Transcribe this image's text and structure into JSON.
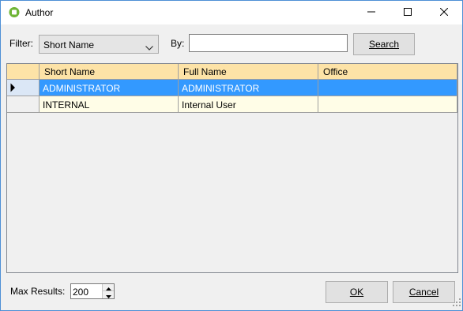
{
  "window": {
    "title": "Author",
    "accent": "#4d8fd6",
    "icons": {
      "app": "green-speech-bubble-icon",
      "minimize": "minimize-icon",
      "maximize": "maximize-icon",
      "close": "close-icon"
    }
  },
  "filter": {
    "filter_label": "Filter:",
    "filter_value": "Short Name",
    "by_label": "By:",
    "by_value": "",
    "search_label": "Search"
  },
  "grid": {
    "header_color": "#fde3a7",
    "selected_color": "#3399ff",
    "columns": [
      "Short Name",
      "Full Name",
      "Office"
    ],
    "rows": [
      {
        "short_name": "ADMINISTRATOR",
        "full_name": "ADMINISTRATOR",
        "office": "",
        "selected": true
      },
      {
        "short_name": "INTERNAL",
        "full_name": "Internal User",
        "office": "",
        "selected": false
      }
    ]
  },
  "footer": {
    "max_results_label": "Max Results:",
    "max_results_value": "200",
    "ok_label": "OK",
    "cancel_label": "Cancel"
  }
}
